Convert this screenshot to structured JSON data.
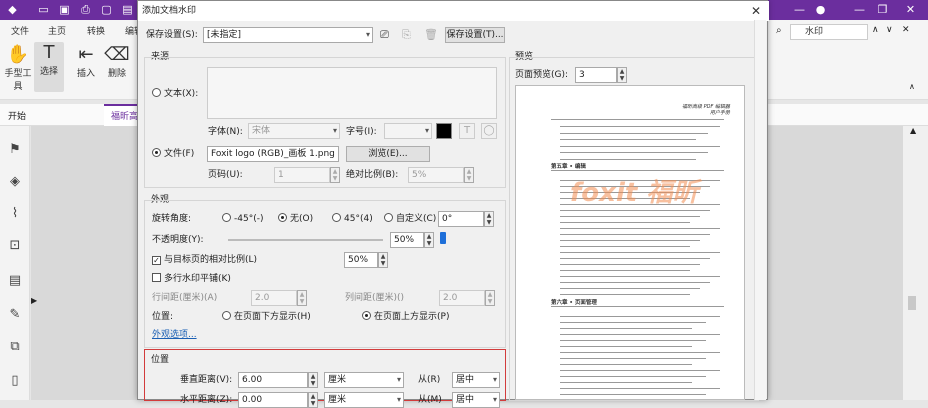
{
  "app": {
    "menus": [
      "文件",
      "主页",
      "转换",
      "编辑"
    ],
    "ribbon_buttons": [
      "手型工具",
      "选择",
      "插入",
      "删除"
    ],
    "tab_start": "开始",
    "tab_doc": "福昕高级...",
    "search_value": "水印"
  },
  "dialog": {
    "title": "添加文档水印",
    "save_settings_label": "保存设置(S):",
    "save_settings_value": "[未指定]",
    "save_settings_button": "保存设置(T)...",
    "source": {
      "group_label": "来源",
      "text_radio": "文本(X):",
      "font_label": "字体(N):",
      "font_value": "宋体",
      "size_label": "字号(I):",
      "file_radio": "文件(F)",
      "file_value": "Foxit logo (RGB)_画板 1.png",
      "browse_button": "浏览(E)...",
      "page_label": "页码(U):",
      "page_value": "1",
      "abs_scale_label": "绝对比例(B):",
      "abs_scale_value": "5%"
    },
    "appearance": {
      "group_label": "外观",
      "rotation_label": "旋转角度:",
      "rot_neg45": "-45°(-)",
      "rot_none": "无(O)",
      "rot_45": "45°(4)",
      "rot_custom": "自定义(C)",
      "rot_custom_value": "0°",
      "opacity_label": "不透明度(Y):",
      "opacity_value": "50%",
      "opacity_fraction": 0.5,
      "relative_scale_label": "与目标页的相对比例(L)",
      "relative_scale_value": "50%",
      "tile_label": "多行水印平铺(K)",
      "row_spacing_label": "行间距(厘米)(A)",
      "row_spacing_value": "2.0",
      "col_spacing_label": "列间距(厘米)()",
      "col_spacing_value": "2.0",
      "position_label": "位置:",
      "pos_below": "在页面下方显示(H)",
      "pos_above": "在页面上方显示(P)",
      "more_options_link": "外观选项..."
    },
    "position": {
      "group_label": "位置",
      "vdist_label": "垂直距离(V):",
      "vdist_value": "6.00",
      "vdist_unit": "厘米",
      "vfrom_label": "从(R)",
      "vfrom_value": "居中",
      "hdist_label": "水平距离(Z):",
      "hdist_value": "0.00",
      "hdist_unit": "厘米",
      "hfrom_label": "从(M)",
      "hfrom_value": "居中"
    },
    "preview": {
      "group_label": "预览",
      "page_preview_label": "页面预览(G):",
      "page_preview_value": "3",
      "page_header": "福昕高级 PDF 编辑器\n用户手册",
      "watermark_text": "foxit 福昕",
      "chapter5": "第五章 • 编辑",
      "chapter6": "第六章 • 页面管理"
    }
  }
}
